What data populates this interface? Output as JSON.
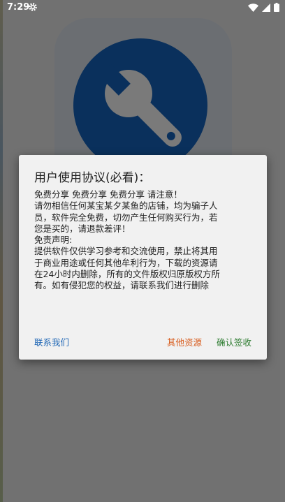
{
  "status_bar": {
    "time": "7:29",
    "icons": [
      "gear-icon",
      "wifi-icon",
      "signal-icon",
      "battery-icon"
    ]
  },
  "background_app": {
    "icon": "wrench-icon",
    "accent_color": "#1565c0"
  },
  "dialog": {
    "title": "用户使用协议(必看)：",
    "body_lines": [
      "免费分享 免费分享 免费分享 请注意！",
      "请勿相信任何某宝某夕某鱼的店铺，均为骗子人",
      "员，软件完全免费，切勿产生任何购买行为，若",
      "您是买的，请退款差评！",
      "免责声明:",
      "提供软件仅供学习参考和交流使用，禁止将其用",
      "于商业用途或任何其他牟利行为，下载的资源请",
      "在24小时内删除，所有的文件版权归原版权方所",
      "有。如有侵犯您的权益，请联系我们进行删除"
    ],
    "buttons": {
      "contact": "联系我们",
      "other_resources": "其他资源",
      "confirm": "确认签收"
    },
    "colors": {
      "contact": "#1e66b5",
      "other_resources": "#d85a1a",
      "confirm": "#2f7d32"
    }
  }
}
